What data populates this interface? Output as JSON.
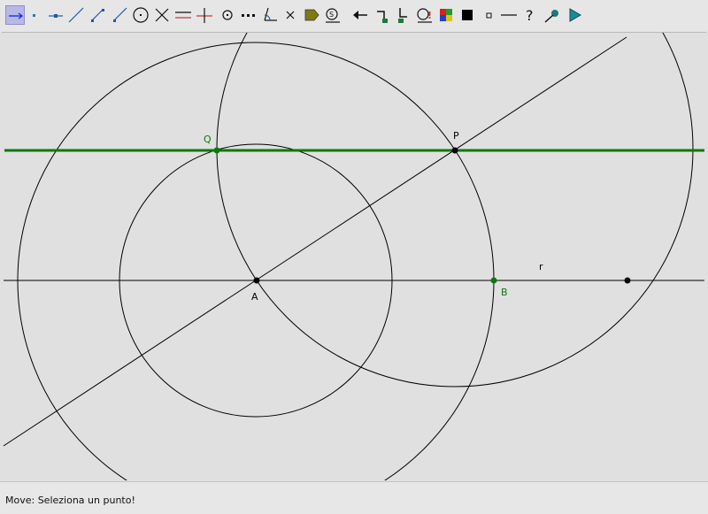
{
  "toolbar": {
    "tools": [
      {
        "name": "move-tool-icon",
        "active": true
      },
      {
        "name": "new-point-icon"
      },
      {
        "name": "point-on-line-icon"
      },
      {
        "name": "line-through-two-points-icon"
      },
      {
        "name": "segment-icon"
      },
      {
        "name": "ray-icon"
      },
      {
        "name": "circle-center-point-icon"
      },
      {
        "name": "intersect-icon"
      },
      {
        "name": "parallel-line-icon"
      },
      {
        "name": "perpendicular-line-icon"
      },
      {
        "name": "midpoint-icon"
      },
      {
        "name": "locus-dots-icon"
      },
      {
        "name": "angle-icon"
      },
      {
        "name": "delete-icon"
      },
      {
        "name": "fill-tag-icon"
      },
      {
        "name": "macro-icon"
      },
      {
        "name": "undo-icon"
      },
      {
        "name": "show-hide-icon"
      },
      {
        "name": "trace-icon"
      },
      {
        "name": "zoom-alert-icon"
      },
      {
        "name": "color-palette-icon"
      },
      {
        "name": "big-square-point-icon"
      },
      {
        "name": "small-square-point-icon"
      },
      {
        "name": "thin-line-icon"
      },
      {
        "name": "help-icon"
      },
      {
        "name": "settings-pin-icon"
      },
      {
        "name": "play-icon"
      }
    ]
  },
  "canvas": {
    "labels": {
      "Q": "Q",
      "P": "P",
      "A": "A",
      "B": "B",
      "r": "r"
    },
    "colors": {
      "background": "#e0e0e0",
      "line": "#000000",
      "green_line": "#0a7a0a",
      "green_point": "#0a7a0a"
    }
  },
  "status": {
    "text": "Move: Seleziona un punto!"
  }
}
